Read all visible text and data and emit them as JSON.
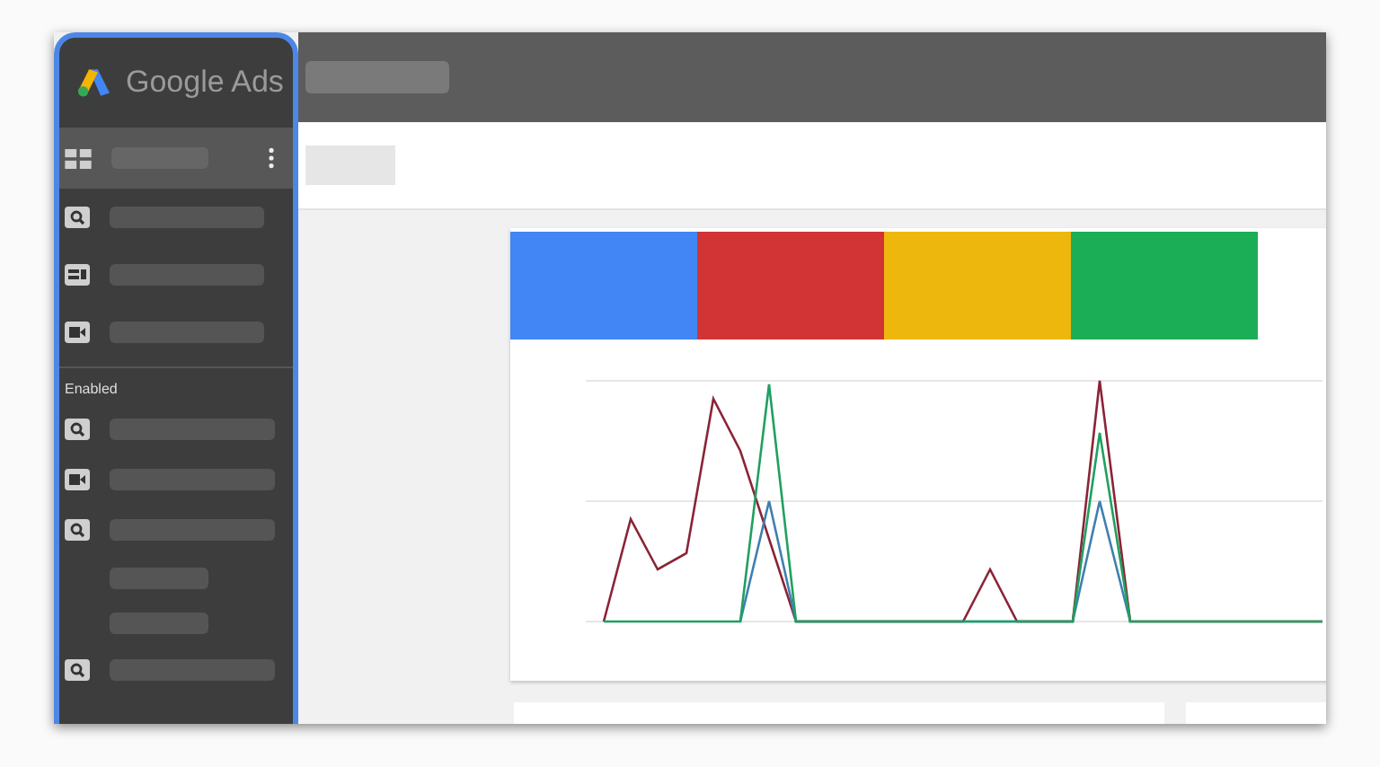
{
  "sidebar": {
    "title": "Google Ads",
    "items": [
      {
        "kind": "grid",
        "selected": true
      },
      {
        "kind": "search",
        "selected": false
      },
      {
        "kind": "display",
        "selected": false
      },
      {
        "kind": "video",
        "selected": false
      }
    ],
    "section_label": "Enabled",
    "section_items": [
      {
        "kind": "search",
        "selected": false
      },
      {
        "kind": "video",
        "selected": false
      },
      {
        "kind": "search",
        "selected": false
      },
      {
        "kind": "blank",
        "selected": false
      },
      {
        "kind": "blank",
        "selected": false
      },
      {
        "kind": "search",
        "selected": false
      }
    ]
  },
  "color_strip": [
    {
      "color": "#4285f4"
    },
    {
      "color": "#d23436"
    },
    {
      "color": "#eeb70d"
    },
    {
      "color": "#1bae57"
    }
  ]
}
